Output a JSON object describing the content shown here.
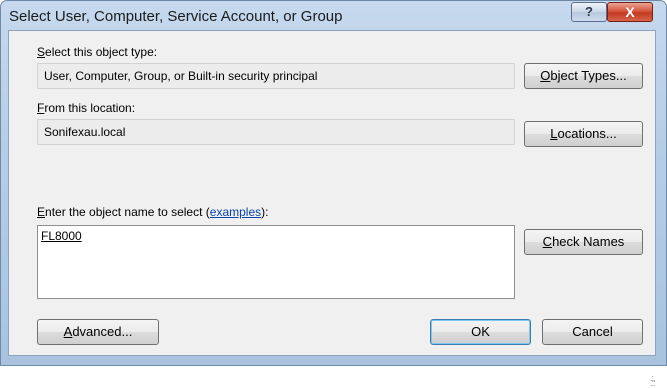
{
  "window": {
    "title": "Select User, Computer, Service Account, or Group"
  },
  "caption_buttons": {
    "help": "?",
    "close": "X"
  },
  "object_type": {
    "label": "Select this object type:",
    "value": "User, Computer, Group, or Built-in security principal",
    "button": "Object Types..."
  },
  "location": {
    "label": "From this location:",
    "value": "Sonifexau.local",
    "button": "Locations..."
  },
  "object_name": {
    "label": "Enter the object name to select",
    "label_open_paren": "(",
    "examples_link": "examples",
    "label_close": "):",
    "value": "FL8000",
    "check_button": "Check Names"
  },
  "buttons": {
    "advanced": "Advanced...",
    "ok": "OK",
    "cancel": "Cancel"
  }
}
